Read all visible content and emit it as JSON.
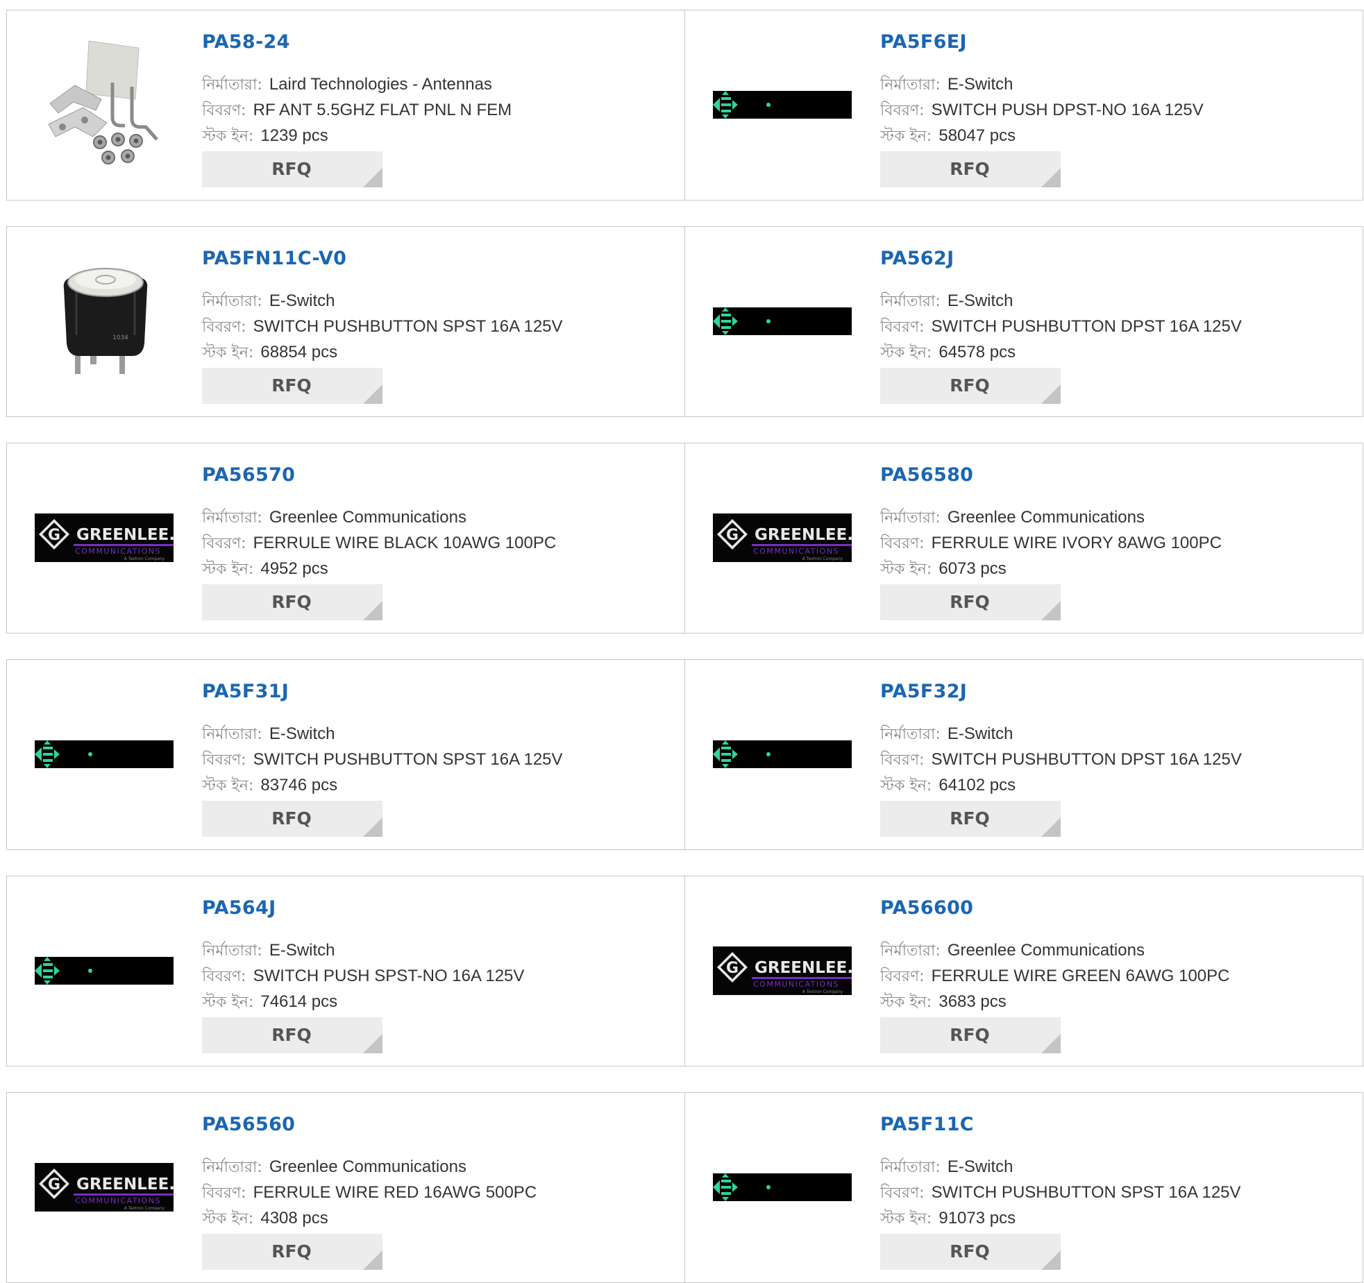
{
  "labels": {
    "manufacturer": "নির্মাতারা:",
    "description": "বিবরণ:",
    "stock": "স্টক ইন:",
    "rfq": "RFQ"
  },
  "colors": {
    "part_link": "#1a66b3",
    "label": "#8a8a8a",
    "value": "#333333",
    "rfq_bg": "#ececec",
    "card_border": "#c6c6c6",
    "eswitch_green": "#2fd3a0",
    "greenlee_purple": "#7b2cc4"
  },
  "products": [
    {
      "part": "PA58-24",
      "manufacturer": "Laird Technologies - Antennas",
      "description": "RF ANT 5.5GHZ FLAT PNL N FEM",
      "stock": "1239 pcs",
      "image": "antenna-kit"
    },
    {
      "part": "PA5F6EJ",
      "manufacturer": "E-Switch",
      "description": "SWITCH PUSH DPST-NO 16A 125V",
      "stock": "58047 pcs",
      "image": "eswitch-logo"
    },
    {
      "part": "PA5FN11C-V0",
      "manufacturer": "E-Switch",
      "description": "SWITCH PUSHBUTTON SPST 16A 125V",
      "stock": "68854 pcs",
      "image": "pushbutton-switch"
    },
    {
      "part": "PA562J",
      "manufacturer": "E-Switch",
      "description": "SWITCH PUSHBUTTON DPST 16A 125V",
      "stock": "64578 pcs",
      "image": "eswitch-logo"
    },
    {
      "part": "PA56570",
      "manufacturer": "Greenlee Communications",
      "description": "FERRULE WIRE BLACK 10AWG 100PC",
      "stock": "4952 pcs",
      "image": "greenlee-logo"
    },
    {
      "part": "PA56580",
      "manufacturer": "Greenlee Communications",
      "description": "FERRULE WIRE IVORY 8AWG 100PC",
      "stock": "6073 pcs",
      "image": "greenlee-logo"
    },
    {
      "part": "PA5F31J",
      "manufacturer": "E-Switch",
      "description": "SWITCH PUSHBUTTON SPST 16A 125V",
      "stock": "83746 pcs",
      "image": "eswitch-logo"
    },
    {
      "part": "PA5F32J",
      "manufacturer": "E-Switch",
      "description": "SWITCH PUSHBUTTON DPST 16A 125V",
      "stock": "64102 pcs",
      "image": "eswitch-logo"
    },
    {
      "part": "PA564J",
      "manufacturer": "E-Switch",
      "description": "SWITCH PUSH SPST-NO 16A 125V",
      "stock": "74614 pcs",
      "image": "eswitch-logo"
    },
    {
      "part": "PA56600",
      "manufacturer": "Greenlee Communications",
      "description": "FERRULE WIRE GREEN 6AWG 100PC",
      "stock": "3683 pcs",
      "image": "greenlee-logo"
    },
    {
      "part": "PA56560",
      "manufacturer": "Greenlee Communications",
      "description": "FERRULE WIRE RED 16AWG 500PC",
      "stock": "4308 pcs",
      "image": "greenlee-logo"
    },
    {
      "part": "PA5F11C",
      "manufacturer": "E-Switch",
      "description": "SWITCH PUSHBUTTON SPST 16A 125V",
      "stock": "91073 pcs",
      "image": "eswitch-logo"
    }
  ]
}
